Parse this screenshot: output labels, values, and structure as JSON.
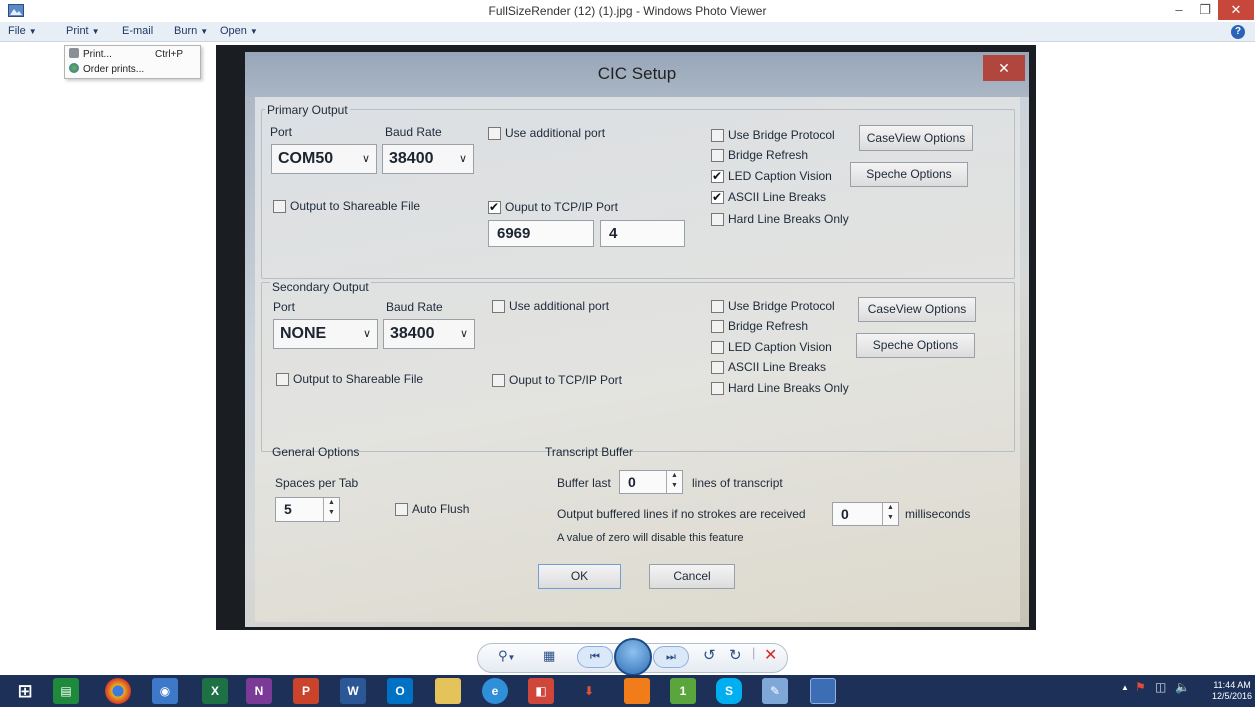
{
  "window": {
    "title": "FullSizeRender (12) (1).jpg - Windows Photo Viewer"
  },
  "menubar": {
    "items": [
      {
        "label": "File"
      },
      {
        "label": "Print"
      },
      {
        "label": "E-mail"
      },
      {
        "label": "Burn"
      },
      {
        "label": "Open"
      }
    ]
  },
  "print_menu": {
    "items": [
      {
        "label": "Print...",
        "shortcut": "Ctrl+P"
      },
      {
        "label": "Order prints...",
        "shortcut": ""
      }
    ]
  },
  "dialog": {
    "title": "CIC Setup",
    "primary": {
      "group_label": "Primary Output",
      "port_label": "Port",
      "baud_label": "Baud Rate",
      "port_value": "COM50",
      "baud_value": "38400",
      "use_additional_port": "Use additional port",
      "output_shareable": "Output to Shareable File",
      "output_tcp": "Ouput to TCP/IP Port",
      "tcp_port_value": "6969",
      "tcp_second_value": "4",
      "use_bridge": "Use Bridge Protocol",
      "bridge_refresh": "Bridge Refresh",
      "led_caption": "LED Caption Vision",
      "ascii_breaks": "ASCII Line Breaks",
      "hard_breaks": "Hard Line Breaks Only",
      "caseview_btn": "CaseView Options",
      "speche_btn": "Speche Options"
    },
    "secondary": {
      "group_label": "Secondary Output",
      "port_label": "Port",
      "baud_label": "Baud Rate",
      "port_value": "NONE",
      "baud_value": "38400",
      "use_additional_port": "Use additional port",
      "output_shareable": "Output to Shareable File",
      "output_tcp": "Ouput to TCP/IP Port",
      "use_bridge": "Use Bridge Protocol",
      "bridge_refresh": "Bridge Refresh",
      "led_caption": "LED Caption Vision",
      "ascii_breaks": "ASCII Line Breaks",
      "hard_breaks": "Hard Line Breaks Only",
      "caseview_btn": "CaseView Options",
      "speche_btn": "Speche Options"
    },
    "general": {
      "group_label": "General Options",
      "spaces_label": "Spaces per Tab",
      "spaces_value": "5",
      "auto_flush": "Auto Flush"
    },
    "transcript": {
      "group_label": "Transcript Buffer",
      "buffer_last": "Buffer last",
      "buffer_value": "0",
      "lines_label": "lines of transcript",
      "output_buffered": "Output buffered lines if no strokes are received",
      "ms_value": "0",
      "ms_label": "milliseconds",
      "note": "A value of zero will disable this feature"
    },
    "ok_btn": "OK",
    "cancel_btn": "Cancel"
  },
  "taskbar": {
    "apps": [
      "store",
      "chrome",
      "network",
      "excel",
      "onenote",
      "powerpoint",
      "word",
      "outlook",
      "explorer",
      "ie",
      "office",
      "usb",
      "orange",
      "onenote-green",
      "skype",
      "pen",
      "photos"
    ],
    "time": "11:44 AM",
    "date": "12/5/2016"
  }
}
